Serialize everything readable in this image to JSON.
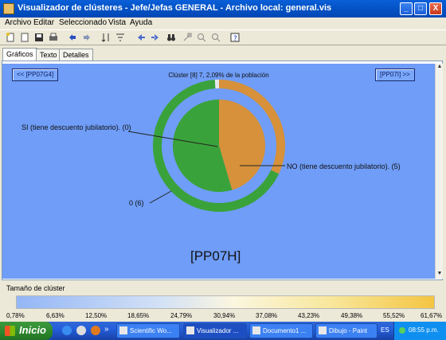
{
  "window": {
    "title": "Visualizador de clústeres - Jefe/Jefas GENERAL - Archivo local: general.vis",
    "minimize": "_",
    "maximize": "□",
    "close": "X"
  },
  "menu": [
    "Archivo",
    "Editar",
    "Seleccionado",
    "Vista",
    "Ayuda"
  ],
  "toolbar_icons": [
    "new-icon",
    "open-icon",
    "save-icon",
    "print-icon",
    "undo-icon",
    "redo-icon",
    "sort-icon",
    "filter-icon",
    "arrow-left-icon",
    "arrow-right-icon",
    "binoculars-icon",
    "select-icon",
    "zoom-in-icon",
    "zoom-out-icon",
    "help-icon"
  ],
  "tabs": [
    {
      "label": "Gráficos",
      "active": true
    },
    {
      "label": "Texto",
      "active": false
    },
    {
      "label": "Detalles",
      "active": false
    }
  ],
  "plot": {
    "prev_button": "<< [PP07G4]",
    "next_button": "[PP07I] >>",
    "header": "Clúster [8] 7, 2,09% de la población",
    "cluster_name": "[PP07H]",
    "labels": {
      "si": "SI  (tiene descuento jubilatorio). (0)",
      "no": "NO  (tiene descuento jubilatorio). (5)",
      "zero": "0 (6)"
    },
    "background": "#6f9df7"
  },
  "chart_data": {
    "type": "pie",
    "title": "",
    "inner_ring": {
      "slices": [
        {
          "label": "NO (tiene descuento jubilatorio).",
          "value": 5,
          "color": "#d6913a"
        },
        {
          "label": "0",
          "value": 6,
          "color": "#3aa23a"
        },
        {
          "label": "SI (tiene descuento jubilatorio).",
          "value": 0,
          "color": "#3aa23a"
        }
      ]
    },
    "outer_ring": {
      "slices": [
        {
          "label": "NO",
          "percent": 32,
          "color": "#d6913a"
        },
        {
          "label": "0",
          "percent": 67,
          "color": "#3aa23a"
        },
        {
          "label": "SI",
          "percent": 1,
          "color": "#e8e8e8"
        }
      ]
    }
  },
  "legend": {
    "title": "Tamaño de clúster",
    "ticks": [
      "0,78%",
      "6,63%",
      "12,50%",
      "18,65%",
      "24,79%",
      "30,94%",
      "37,08%",
      "43,23%",
      "49,38%",
      "55,52%",
      "61,67%"
    ]
  },
  "taskbar": {
    "start_label": "Inicio",
    "chevron": "»",
    "tasks": [
      {
        "label": "Scientific Wo...",
        "active": false
      },
      {
        "label": "Visualizador ...",
        "active": true
      },
      {
        "label": "Documento1 ...",
        "active": false
      },
      {
        "label": "Dibujo - Paint",
        "active": false
      }
    ],
    "lang": "ES",
    "clock": "08:55 p.m."
  }
}
